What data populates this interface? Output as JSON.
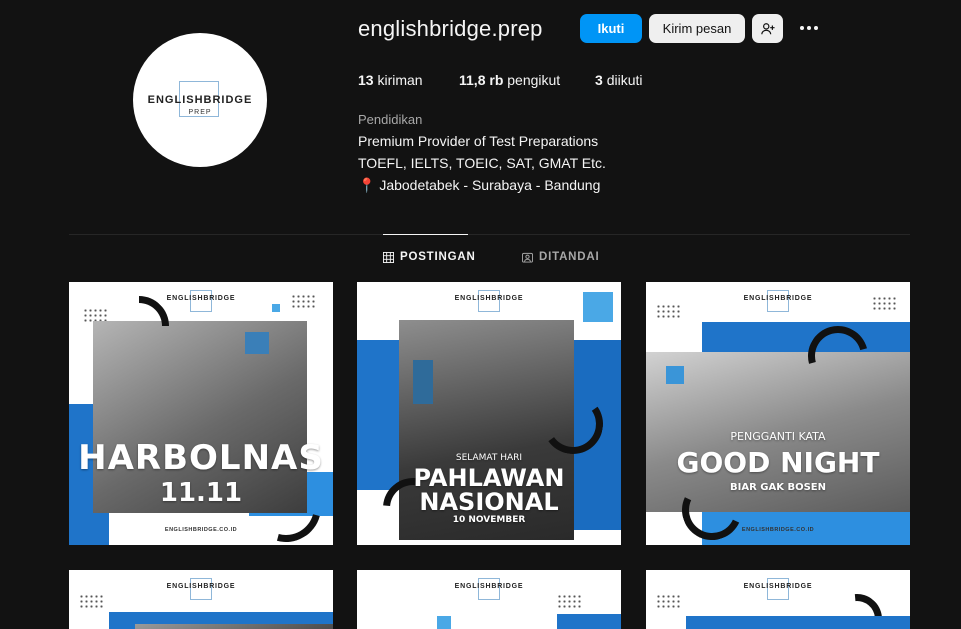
{
  "profile": {
    "username": "englishbridge.prep",
    "avatar_line1": "ENGLISHBRIDGE",
    "avatar_line2": "PREP",
    "follow_label": "Ikuti",
    "message_label": "Kirim pesan",
    "stats": {
      "posts_count": "13",
      "posts_label": "kiriman",
      "followers_count": "11,8 rb",
      "followers_label": "pengikut",
      "following_count": "3",
      "following_label": "diikuti"
    },
    "category": "Pendidikan",
    "bio": [
      "Premium Provider of Test Preparations",
      "TOEFL, IELTS, TOEIC, SAT, GMAT Etc.",
      "📍 Jabodetabek - Surabaya - Bandung"
    ]
  },
  "tabs": [
    {
      "label": "POSTINGAN",
      "icon": "grid-icon",
      "active": true
    },
    {
      "label": "DITANDAI",
      "icon": "tag-icon",
      "active": false
    }
  ],
  "posts": [
    {
      "logo": "ENGLISHBRIDGE",
      "title1": "HARBOLNAS",
      "title2": "11.11",
      "footer": "ENGLISHBRIDGE.CO.ID"
    },
    {
      "logo": "ENGLISHBRIDGE",
      "kicker": "SELAMAT HARI",
      "title1": "PAHLAWAN",
      "title2": "NASIONAL",
      "sub": "10 NOVEMBER"
    },
    {
      "logo": "ENGLISHBRIDGE",
      "kicker": "PENGGANTI KATA",
      "title1": "GOOD NIGHT",
      "sub": "BIAR GAK BOSEN",
      "footer": "ENGLISHBRIDGE.CO.ID"
    },
    {
      "logo": "ENGLISHBRIDGE"
    },
    {
      "logo": "ENGLISHBRIDGE"
    },
    {
      "logo": "ENGLISHBRIDGE"
    }
  ],
  "colors": {
    "accent": "#0095f6",
    "brand_blue": "#1f74c9",
    "light_blue": "#4aa8e6",
    "background": "#121212"
  }
}
